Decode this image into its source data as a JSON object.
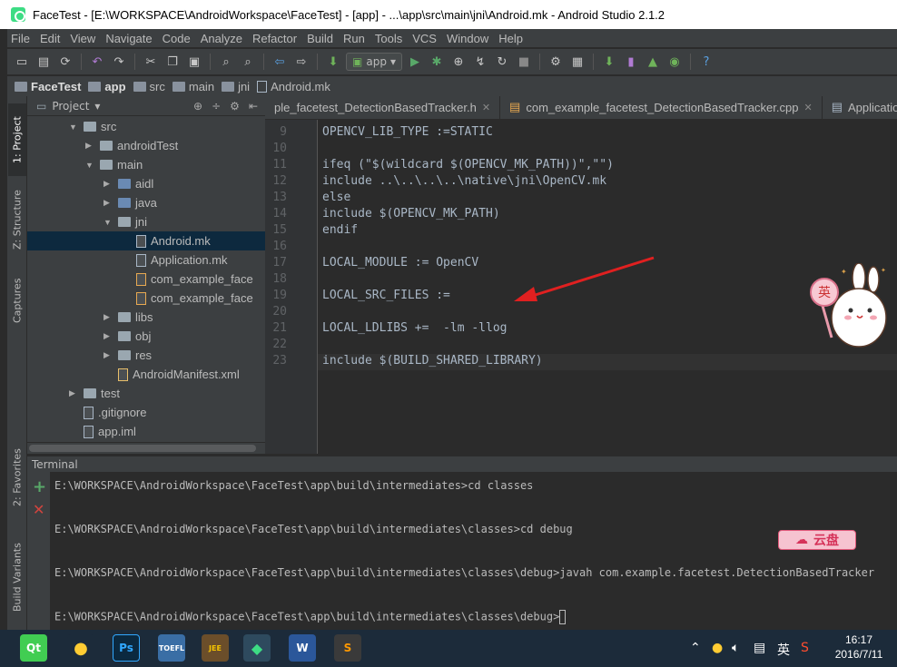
{
  "window": {
    "title": "FaceTest - [E:\\WORKSPACE\\AndroidWorkspace\\FaceTest] - [app] - ...\\app\\src\\main\\jni\\Android.mk - Android Studio 2.1.2"
  },
  "menu": [
    "File",
    "Edit",
    "View",
    "Navigate",
    "Code",
    "Analyze",
    "Refactor",
    "Build",
    "Run",
    "Tools",
    "VCS",
    "Window",
    "Help"
  ],
  "toolbar": {
    "run_config": "app"
  },
  "breadcrumb": [
    "FaceTest",
    "app",
    "src",
    "main",
    "jni",
    "Android.mk"
  ],
  "left_tabs": {
    "project": "1: Project",
    "structure": "Z: Structure",
    "captures": "Captures",
    "favorites": "2: Favorites",
    "build_variants": "Build Variants"
  },
  "project": {
    "header": "Project",
    "tree": [
      {
        "label": "src",
        "type": "folder",
        "expanded": true
      },
      {
        "label": "androidTest",
        "type": "folder",
        "expanded": false
      },
      {
        "label": "main",
        "type": "folder",
        "expanded": true
      },
      {
        "label": "aidl",
        "type": "folder-blue",
        "expanded": false
      },
      {
        "label": "java",
        "type": "folder-blue",
        "expanded": false
      },
      {
        "label": "jni",
        "type": "folder",
        "expanded": true
      },
      {
        "label": "Android.mk",
        "type": "file",
        "selected": true
      },
      {
        "label": "Application.mk",
        "type": "file"
      },
      {
        "label": "com_example_face",
        "type": "file-cpp"
      },
      {
        "label": "com_example_face",
        "type": "file-cpp"
      },
      {
        "label": "libs",
        "type": "folder",
        "expanded": false
      },
      {
        "label": "obj",
        "type": "folder",
        "expanded": false
      },
      {
        "label": "res",
        "type": "folder",
        "expanded": false
      },
      {
        "label": "AndroidManifest.xml",
        "type": "file-xml"
      },
      {
        "label": "test",
        "type": "folder",
        "expanded": false
      },
      {
        "label": ".gitignore",
        "type": "file"
      },
      {
        "label": "app.iml",
        "type": "file"
      }
    ]
  },
  "editor_tabs": [
    {
      "label": "ple_facetest_DetectionBasedTracker.h"
    },
    {
      "label": "com_example_facetest_DetectionBasedTracker.cpp"
    },
    {
      "label": "Application.mk"
    }
  ],
  "code": [
    {
      "n": "9",
      "text": "OPENCV_LIB_TYPE :=STATIC"
    },
    {
      "n": "10",
      "text": ""
    },
    {
      "n": "11",
      "text": "ifeq (\"$(wildcard $(OPENCV_MK_PATH))\",\"\")"
    },
    {
      "n": "12",
      "text": "include ..\\..\\..\\..\\native\\jni\\OpenCV.mk"
    },
    {
      "n": "13",
      "text": "else"
    },
    {
      "n": "14",
      "text": "include $(OPENCV_MK_PATH)"
    },
    {
      "n": "15",
      "text": "endif"
    },
    {
      "n": "16",
      "text": ""
    },
    {
      "n": "17",
      "text": "LOCAL_MODULE := OpenCV"
    },
    {
      "n": "18",
      "text": ""
    },
    {
      "n": "19",
      "text": "LOCAL_SRC_FILES :="
    },
    {
      "n": "20",
      "text": ""
    },
    {
      "n": "21",
      "text": "LOCAL_LDLIBS +=  -lm -llog"
    },
    {
      "n": "22",
      "text": ""
    },
    {
      "n": "23",
      "text": "include $(BUILD_SHARED_LIBRARY)"
    }
  ],
  "terminal": {
    "title": "Terminal",
    "lines": [
      "E:\\WORKSPACE\\AndroidWorkspace\\FaceTest\\app\\build\\intermediates>cd classes",
      "E:\\WORKSPACE\\AndroidWorkspace\\FaceTest\\app\\build\\intermediates\\classes>cd debug",
      "E:\\WORKSPACE\\AndroidWorkspace\\FaceTest\\app\\build\\intermediates\\classes\\debug>javah com.example.facetest.DetectionBasedTracker",
      "E:\\WORKSPACE\\AndroidWorkspace\\FaceTest\\app\\build\\intermediates\\classes\\debug>"
    ]
  },
  "overlay": {
    "yunpan": "云盘",
    "mascot_badge": "英"
  },
  "taskbar": {
    "ime": "英",
    "time": "16:17",
    "date": "2016/7/11"
  }
}
